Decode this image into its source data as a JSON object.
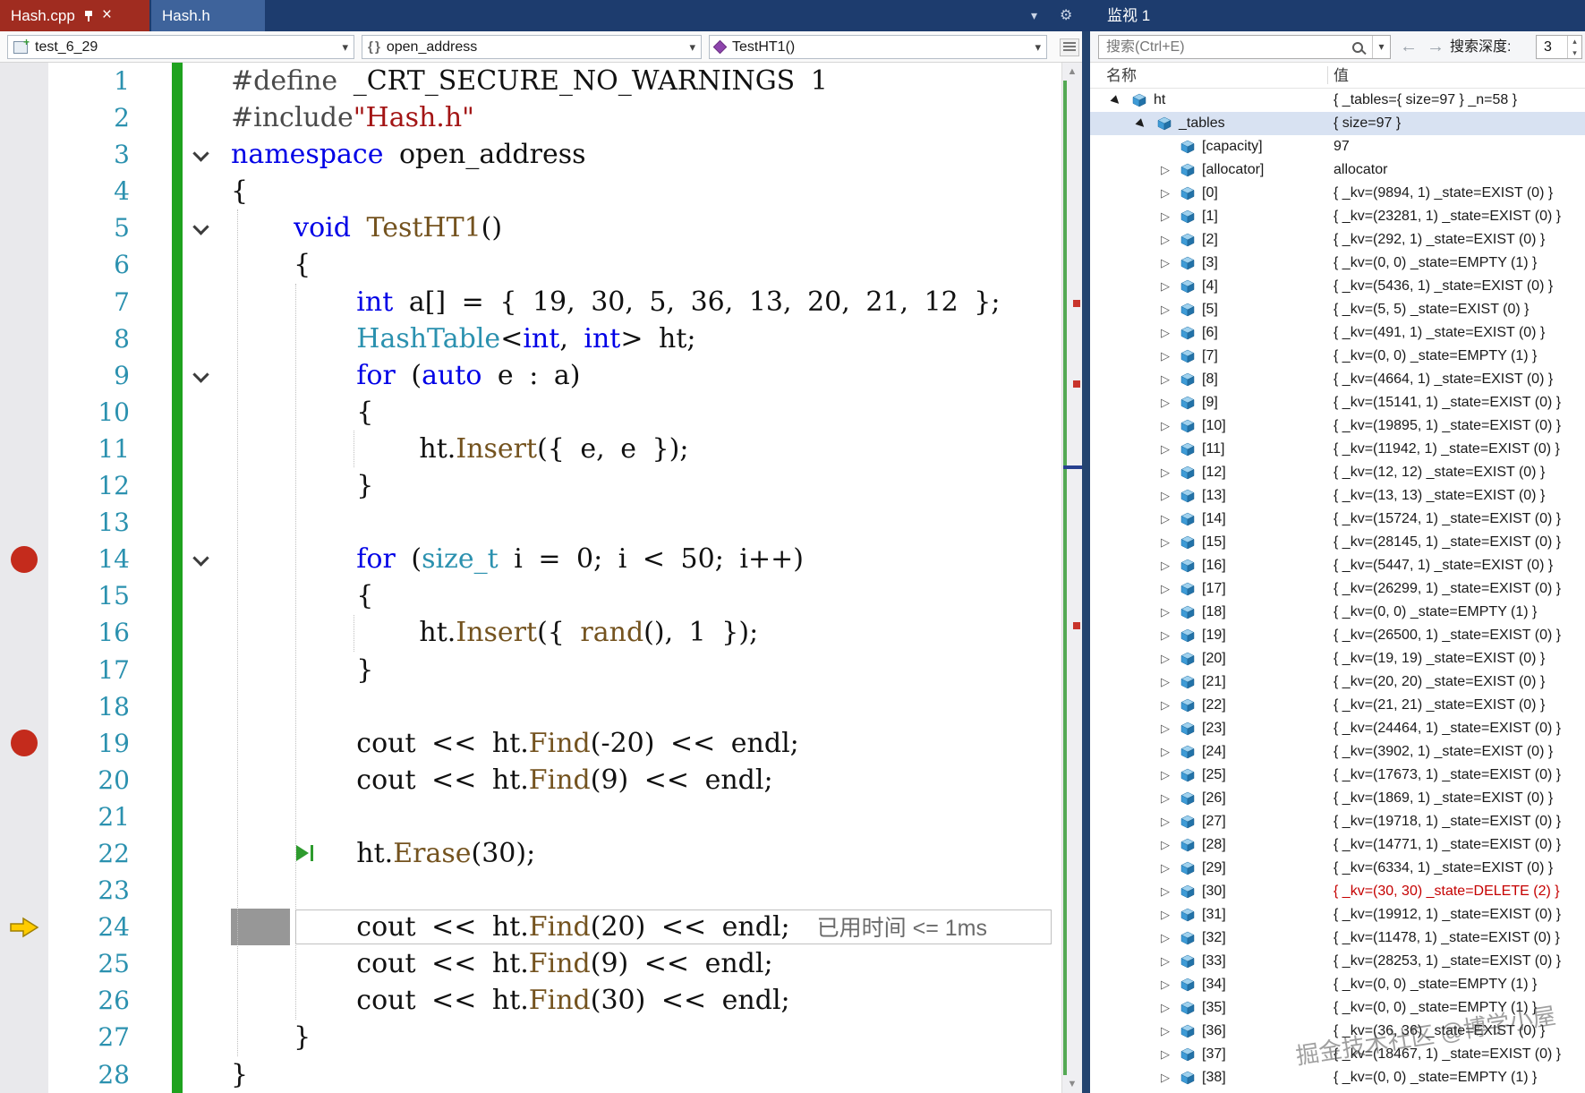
{
  "tabs": [
    {
      "label": "Hash.cpp",
      "close": "×"
    },
    {
      "label": "Hash.h"
    }
  ],
  "navbar": {
    "project": "test_6_29",
    "scope_icon": "{ }",
    "scope": "open_address",
    "function": "TestHT1()"
  },
  "watch": {
    "title": "监视 1",
    "search_placeholder": "搜索(Ctrl+E)",
    "depth_label": "搜索深度:",
    "depth_value": "3",
    "columns": [
      "名称",
      "值"
    ],
    "rows": [
      {
        "name": "ht",
        "value": "{ _tables={ size=97 } _n=58 }",
        "level": 0,
        "state": "expanded"
      },
      {
        "name": "_tables",
        "value": "{ size=97 }",
        "level": 1,
        "state": "expanded",
        "selected": true
      },
      {
        "name": "[capacity]",
        "value": "97",
        "level": 2,
        "state": "leaf"
      },
      {
        "name": "[allocator]",
        "value": "allocator",
        "level": 2,
        "state": "collapsed"
      },
      {
        "name": "[0]",
        "value": "{ _kv=(9894, 1) _state=EXIST (0) }",
        "level": 2,
        "state": "collapsed"
      },
      {
        "name": "[1]",
        "value": "{ _kv=(23281, 1) _state=EXIST (0) }",
        "level": 2,
        "state": "collapsed"
      },
      {
        "name": "[2]",
        "value": "{ _kv=(292, 1) _state=EXIST (0) }",
        "level": 2,
        "state": "collapsed"
      },
      {
        "name": "[3]",
        "value": "{ _kv=(0, 0) _state=EMPTY (1) }",
        "level": 2,
        "state": "collapsed"
      },
      {
        "name": "[4]",
        "value": "{ _kv=(5436, 1) _state=EXIST (0) }",
        "level": 2,
        "state": "collapsed"
      },
      {
        "name": "[5]",
        "value": "{ _kv=(5, 5) _state=EXIST (0) }",
        "level": 2,
        "state": "collapsed"
      },
      {
        "name": "[6]",
        "value": "{ _kv=(491, 1) _state=EXIST (0) }",
        "level": 2,
        "state": "collapsed"
      },
      {
        "name": "[7]",
        "value": "{ _kv=(0, 0) _state=EMPTY (1) }",
        "level": 2,
        "state": "collapsed"
      },
      {
        "name": "[8]",
        "value": "{ _kv=(4664, 1) _state=EXIST (0) }",
        "level": 2,
        "state": "collapsed"
      },
      {
        "name": "[9]",
        "value": "{ _kv=(15141, 1) _state=EXIST (0) }",
        "level": 2,
        "state": "collapsed"
      },
      {
        "name": "[10]",
        "value": "{ _kv=(19895, 1) _state=EXIST (0) }",
        "level": 2,
        "state": "collapsed"
      },
      {
        "name": "[11]",
        "value": "{ _kv=(11942, 1) _state=EXIST (0) }",
        "level": 2,
        "state": "collapsed"
      },
      {
        "name": "[12]",
        "value": "{ _kv=(12, 12) _state=EXIST (0) }",
        "level": 2,
        "state": "collapsed"
      },
      {
        "name": "[13]",
        "value": "{ _kv=(13, 13) _state=EXIST (0) }",
        "level": 2,
        "state": "collapsed"
      },
      {
        "name": "[14]",
        "value": "{ _kv=(15724, 1) _state=EXIST (0) }",
        "level": 2,
        "state": "collapsed"
      },
      {
        "name": "[15]",
        "value": "{ _kv=(28145, 1) _state=EXIST (0) }",
        "level": 2,
        "state": "collapsed"
      },
      {
        "name": "[16]",
        "value": "{ _kv=(5447, 1) _state=EXIST (0) }",
        "level": 2,
        "state": "collapsed"
      },
      {
        "name": "[17]",
        "value": "{ _kv=(26299, 1) _state=EXIST (0) }",
        "level": 2,
        "state": "collapsed"
      },
      {
        "name": "[18]",
        "value": "{ _kv=(0, 0) _state=EMPTY (1) }",
        "level": 2,
        "state": "collapsed"
      },
      {
        "name": "[19]",
        "value": "{ _kv=(26500, 1) _state=EXIST (0) }",
        "level": 2,
        "state": "collapsed"
      },
      {
        "name": "[20]",
        "value": "{ _kv=(19, 19) _state=EXIST (0) }",
        "level": 2,
        "state": "collapsed"
      },
      {
        "name": "[21]",
        "value": "{ _kv=(20, 20) _state=EXIST (0) }",
        "level": 2,
        "state": "collapsed"
      },
      {
        "name": "[22]",
        "value": "{ _kv=(21, 21) _state=EXIST (0) }",
        "level": 2,
        "state": "collapsed"
      },
      {
        "name": "[23]",
        "value": "{ _kv=(24464, 1) _state=EXIST (0) }",
        "level": 2,
        "state": "collapsed"
      },
      {
        "name": "[24]",
        "value": "{ _kv=(3902, 1) _state=EXIST (0) }",
        "level": 2,
        "state": "collapsed"
      },
      {
        "name": "[25]",
        "value": "{ _kv=(17673, 1) _state=EXIST (0) }",
        "level": 2,
        "state": "collapsed"
      },
      {
        "name": "[26]",
        "value": "{ _kv=(1869, 1) _state=EXIST (0) }",
        "level": 2,
        "state": "collapsed"
      },
      {
        "name": "[27]",
        "value": "{ _kv=(19718, 1) _state=EXIST (0) }",
        "level": 2,
        "state": "collapsed"
      },
      {
        "name": "[28]",
        "value": "{ _kv=(14771, 1) _state=EXIST (0) }",
        "level": 2,
        "state": "collapsed"
      },
      {
        "name": "[29]",
        "value": "{ _kv=(6334, 1) _state=EXIST (0) }",
        "level": 2,
        "state": "collapsed"
      },
      {
        "name": "[30]",
        "value": "{ _kv=(30, 30) _state=DELETE (2) }",
        "level": 2,
        "state": "collapsed",
        "red": true
      },
      {
        "name": "[31]",
        "value": "{ _kv=(19912, 1) _state=EXIST (0) }",
        "level": 2,
        "state": "collapsed"
      },
      {
        "name": "[32]",
        "value": "{ _kv=(11478, 1) _state=EXIST (0) }",
        "level": 2,
        "state": "collapsed"
      },
      {
        "name": "[33]",
        "value": "{ _kv=(28253, 1) _state=EXIST (0) }",
        "level": 2,
        "state": "collapsed"
      },
      {
        "name": "[34]",
        "value": "{ _kv=(0, 0) _state=EMPTY (1) }",
        "level": 2,
        "state": "collapsed"
      },
      {
        "name": "[35]",
        "value": "{ _kv=(0, 0) _state=EMPTY (1) }",
        "level": 2,
        "state": "collapsed"
      },
      {
        "name": "[36]",
        "value": "{ _kv=(36, 36) _state=EXIST (0) }",
        "level": 2,
        "state": "collapsed"
      },
      {
        "name": "[37]",
        "value": "{ _kv=(18467, 1) _state=EXIST (0) }",
        "level": 2,
        "state": "collapsed"
      },
      {
        "name": "[38]",
        "value": "{ _kv=(0, 0) _state=EMPTY (1) }",
        "level": 2,
        "state": "collapsed"
      }
    ]
  },
  "editor": {
    "breakpoints": [
      14,
      19
    ],
    "current_line": 24,
    "fold_lines": [
      3,
      5,
      9,
      14
    ],
    "run_marker_line": 22,
    "perf_tip": "已用时间 <= 1ms",
    "lines": [
      {
        "n": 1,
        "t": [
          [
            "pp",
            "#define "
          ],
          [
            "pl",
            "_CRT_SECURE_NO_WARNINGS 1"
          ]
        ]
      },
      {
        "n": 2,
        "t": [
          [
            "pp",
            "#include"
          ],
          [
            "str",
            "\"Hash.h\""
          ]
        ]
      },
      {
        "n": 3,
        "t": [
          [
            "kw",
            "namespace"
          ],
          [
            "pl",
            " open_address"
          ]
        ]
      },
      {
        "n": 4,
        "t": [
          [
            "pl",
            "{"
          ]
        ]
      },
      {
        "n": 5,
        "t": [
          [
            "pl",
            "    "
          ],
          [
            "kw",
            "void"
          ],
          [
            "pl",
            " "
          ],
          [
            "fn",
            "TestHT1"
          ],
          [
            "pl",
            "()"
          ]
        ]
      },
      {
        "n": 6,
        "t": [
          [
            "pl",
            "    {"
          ]
        ]
      },
      {
        "n": 7,
        "t": [
          [
            "pl",
            "        "
          ],
          [
            "kw",
            "int"
          ],
          [
            "pl",
            " a[] = { 19, 30, 5, 36, 13, 20, 21, 12 };"
          ]
        ]
      },
      {
        "n": 8,
        "t": [
          [
            "pl",
            "        "
          ],
          [
            "ty",
            "HashTable"
          ],
          [
            "pl",
            "<"
          ],
          [
            "kw",
            "int"
          ],
          [
            "pl",
            ", "
          ],
          [
            "kw",
            "int"
          ],
          [
            "pl",
            "> ht;"
          ]
        ]
      },
      {
        "n": 9,
        "t": [
          [
            "pl",
            "        "
          ],
          [
            "kw",
            "for"
          ],
          [
            "pl",
            " ("
          ],
          [
            "kw",
            "auto"
          ],
          [
            "pl",
            " e : a)"
          ]
        ]
      },
      {
        "n": 10,
        "t": [
          [
            "pl",
            "        {"
          ]
        ]
      },
      {
        "n": 11,
        "t": [
          [
            "pl",
            "            ht."
          ],
          [
            "fn",
            "Insert"
          ],
          [
            "pl",
            "({ e, e });"
          ]
        ]
      },
      {
        "n": 12,
        "t": [
          [
            "pl",
            "        }"
          ]
        ]
      },
      {
        "n": 13,
        "t": []
      },
      {
        "n": 14,
        "t": [
          [
            "pl",
            "        "
          ],
          [
            "kw",
            "for"
          ],
          [
            "pl",
            " ("
          ],
          [
            "ty",
            "size_t"
          ],
          [
            "pl",
            " i = 0; i < 50; i++)"
          ]
        ]
      },
      {
        "n": 15,
        "t": [
          [
            "pl",
            "        {"
          ]
        ]
      },
      {
        "n": 16,
        "t": [
          [
            "pl",
            "            ht."
          ],
          [
            "fn",
            "Insert"
          ],
          [
            "pl",
            "({ "
          ],
          [
            "fn",
            "rand"
          ],
          [
            "pl",
            "(), 1 });"
          ]
        ]
      },
      {
        "n": 17,
        "t": [
          [
            "pl",
            "        }"
          ]
        ]
      },
      {
        "n": 18,
        "t": []
      },
      {
        "n": 19,
        "t": [
          [
            "pl",
            "        cout << ht."
          ],
          [
            "fn",
            "Find"
          ],
          [
            "pl",
            "(-20) << endl;"
          ]
        ]
      },
      {
        "n": 20,
        "t": [
          [
            "pl",
            "        cout << ht."
          ],
          [
            "fn",
            "Find"
          ],
          [
            "pl",
            "(9) << endl;"
          ]
        ]
      },
      {
        "n": 21,
        "t": []
      },
      {
        "n": 22,
        "t": [
          [
            "pl",
            "        ht."
          ],
          [
            "fn",
            "Erase"
          ],
          [
            "pl",
            "(30);"
          ]
        ]
      },
      {
        "n": 23,
        "t": []
      },
      {
        "n": 24,
        "t": [
          [
            "pl",
            "        cout << ht."
          ],
          [
            "fn",
            "Find"
          ],
          [
            "pl",
            "(20) << endl;"
          ]
        ]
      },
      {
        "n": 25,
        "t": [
          [
            "pl",
            "        cout << ht."
          ],
          [
            "fn",
            "Find"
          ],
          [
            "pl",
            "(9) << endl;"
          ]
        ]
      },
      {
        "n": 26,
        "t": [
          [
            "pl",
            "        cout << ht."
          ],
          [
            "fn",
            "Find"
          ],
          [
            "pl",
            "(30) << endl;"
          ]
        ]
      },
      {
        "n": 27,
        "t": [
          [
            "pl",
            "    }"
          ]
        ]
      },
      {
        "n": 28,
        "t": [
          [
            "pl",
            "}"
          ]
        ]
      }
    ]
  },
  "watermark": "掘金技术社区 @博学小屋",
  "colors": {
    "active_tab": "#A02C20",
    "inactive_tab": "#3E639B",
    "titlebar": "#1D3C6E",
    "keyword": "#0000E6",
    "type": "#2B91AF",
    "function": "#74531F",
    "string": "#A31515",
    "line_number": "#2B91AF",
    "breakpoint": "#C42B1C",
    "change_bar": "#1FA21F",
    "deleted_entry": "#C50000"
  }
}
